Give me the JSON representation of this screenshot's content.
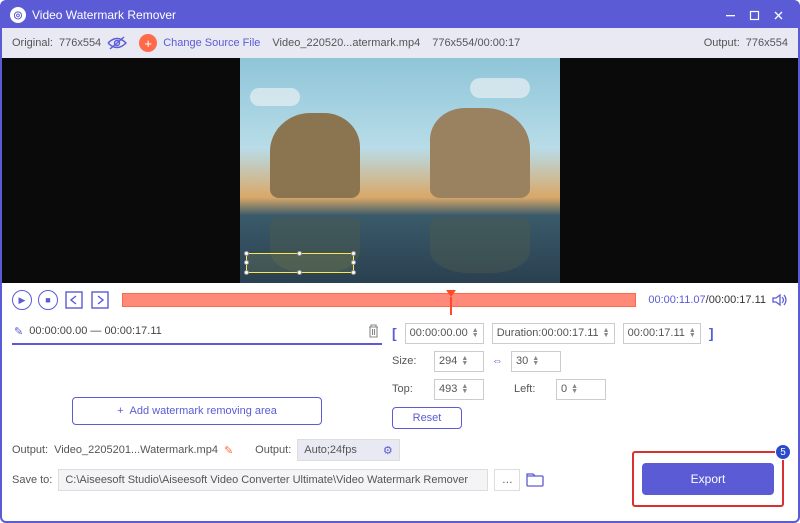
{
  "titlebar": {
    "title": "Video Watermark Remover"
  },
  "toolbar": {
    "original_label": "Original:",
    "original_dims": "776x554",
    "change_source": "Change Source File",
    "filename": "Video_220520...atermark.mp4",
    "meta": "776x554/00:00:17",
    "output_label": "Output:",
    "output_dims": "776x554"
  },
  "playback": {
    "current": "00:00:11.07",
    "total": "00:00:17.11"
  },
  "segment": {
    "range": "00:00:00.00 — 00:00:17.11",
    "add_label": "Add watermark removing area"
  },
  "params": {
    "start": "00:00:00.00",
    "duration_label": "Duration:",
    "duration": "00:00:17.11",
    "end": "00:00:17.11",
    "size_label": "Size:",
    "width": "294",
    "height": "30",
    "top_label": "Top:",
    "top": "493",
    "left_label": "Left:",
    "left": "0",
    "reset": "Reset"
  },
  "output": {
    "out_label": "Output:",
    "out_file": "Video_2205201...Watermark.mp4",
    "format_label": "Output:",
    "format_value": "Auto;24fps",
    "save_label": "Save to:",
    "save_path": "C:\\Aiseesoft Studio\\Aiseesoft Video Converter Ultimate\\Video Watermark Remover"
  },
  "export": {
    "label": "Export",
    "step": "5"
  }
}
